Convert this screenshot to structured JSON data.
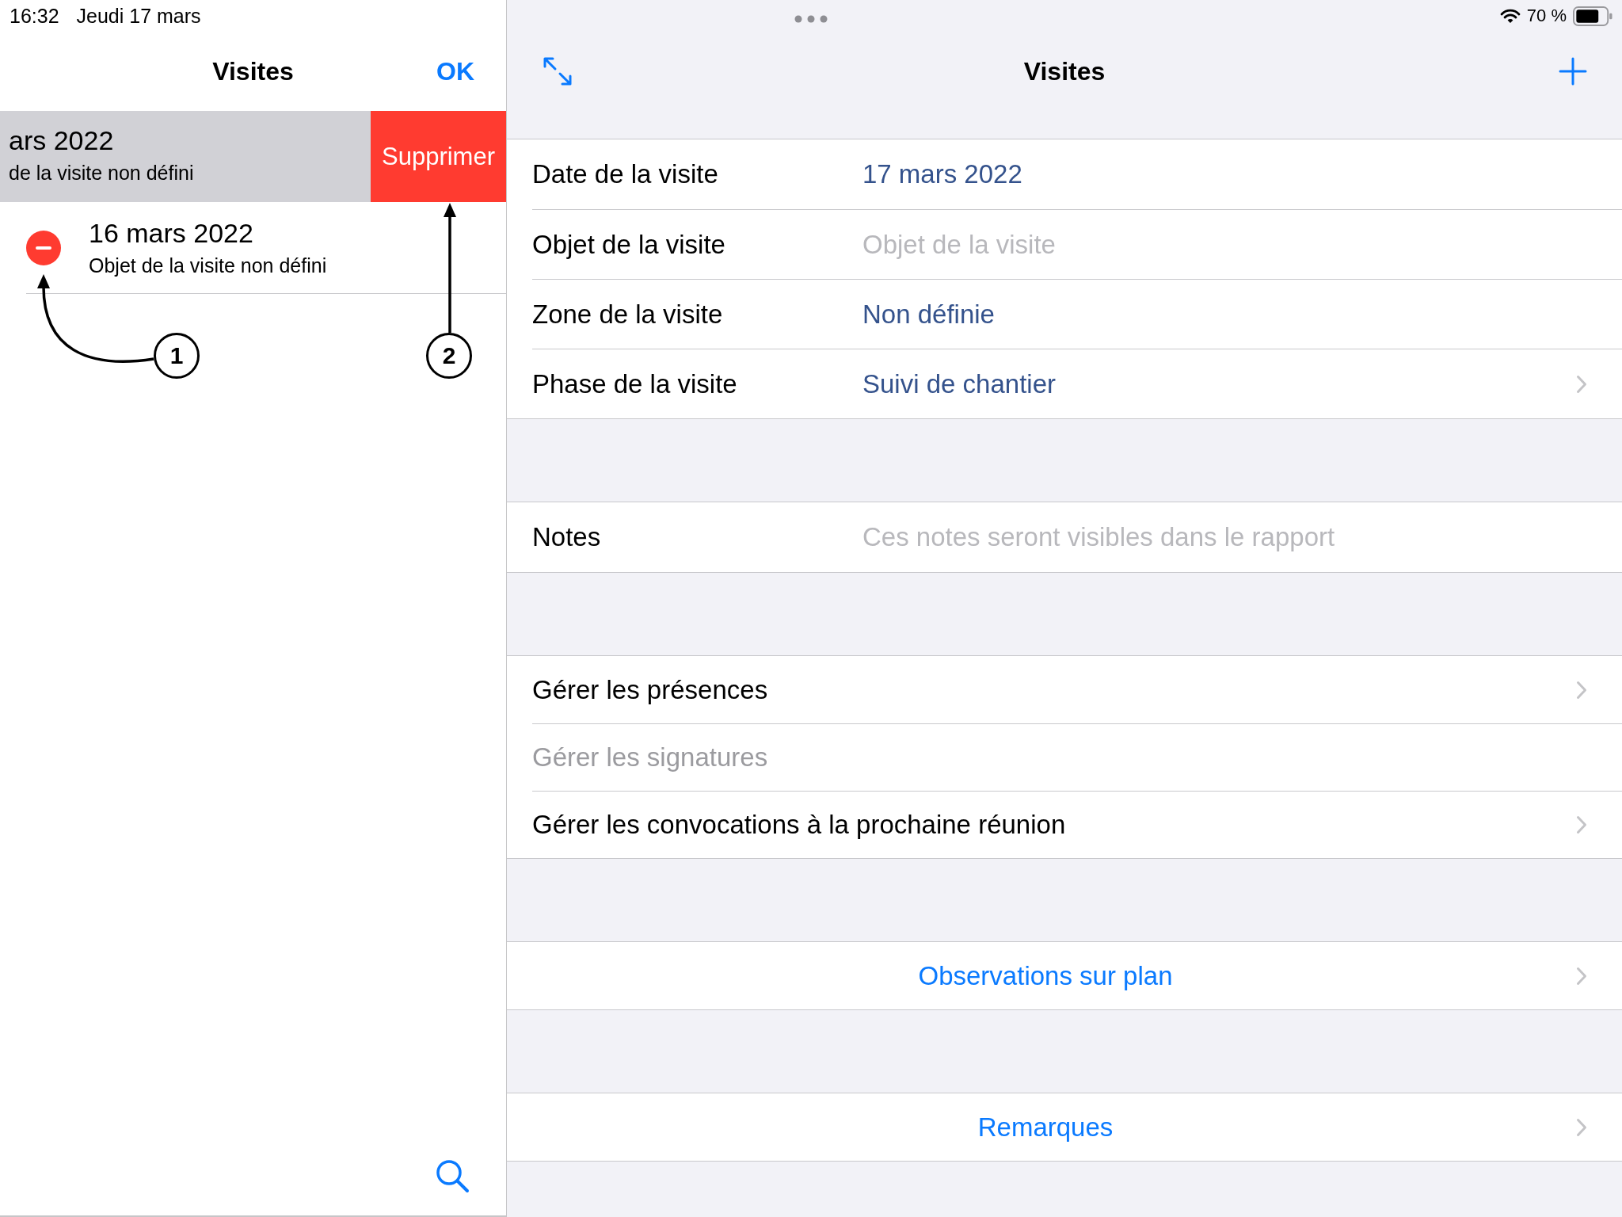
{
  "status_bar": {
    "time": "16:32",
    "date": "Jeudi 17 mars",
    "battery": "70 %"
  },
  "list_panel": {
    "title": "Visites",
    "done_button": "OK",
    "rows": [
      {
        "title": "ars 2022",
        "subtitle": "de la visite non défini",
        "swiped": true,
        "action": "Supprimer"
      },
      {
        "title": "16 mars 2022",
        "subtitle": "Objet de la visite non défini",
        "swiped": false
      }
    ]
  },
  "annotations": [
    {
      "label": "1"
    },
    {
      "label": "2"
    }
  ],
  "detail_panel": {
    "title": "Visites",
    "sections": [
      {
        "rows": [
          {
            "kind": "value",
            "label": "Date de la visite",
            "value": "17 mars 2022"
          },
          {
            "kind": "input",
            "label": "Objet de la visite",
            "placeholder": "Objet de la visite"
          },
          {
            "kind": "value",
            "label": "Zone de la visite",
            "value": "Non définie"
          },
          {
            "kind": "picker",
            "label": "Phase de la visite",
            "value": "Suivi de chantier"
          }
        ]
      },
      {
        "rows": [
          {
            "kind": "input",
            "label": "Notes",
            "placeholder": "Ces notes seront visibles dans le rapport"
          }
        ]
      },
      {
        "rows": [
          {
            "kind": "link",
            "label": "Gérer les présences",
            "disabled": false
          },
          {
            "kind": "link",
            "label": "Gérer les signatures",
            "disabled": true
          },
          {
            "kind": "link",
            "label": "Gérer les convocations à la prochaine réunion",
            "disabled": false
          }
        ]
      },
      {
        "rows": [
          {
            "kind": "action",
            "label": "Observations sur plan"
          }
        ]
      },
      {
        "rows": [
          {
            "kind": "action",
            "label": "Remarques"
          }
        ]
      }
    ]
  }
}
